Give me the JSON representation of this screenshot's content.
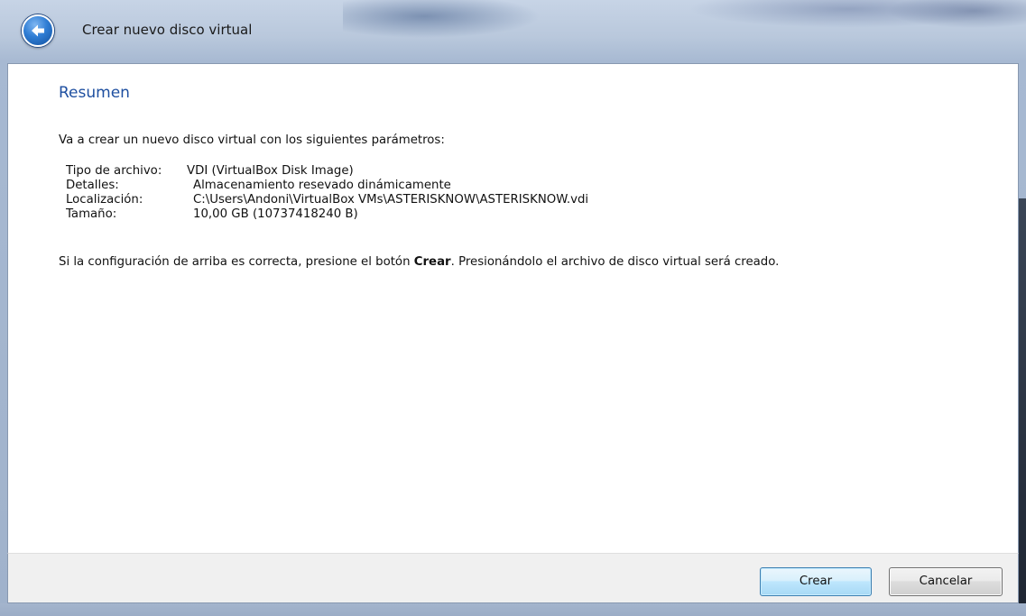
{
  "window": {
    "title": "Crear nuevo disco virtual"
  },
  "page": {
    "title": "Resumen",
    "intro": "Va a crear un nuevo disco virtual con los siguientes parámetros:",
    "params": [
      {
        "label": "Tipo de archivo:",
        "value": "VDI (VirtualBox Disk Image)"
      },
      {
        "label": "Detalles:",
        "value": "Almacenamiento resevado dinámicamente"
      },
      {
        "label": "Localización:",
        "value": "C:\\Users\\Andoni\\VirtualBox VMs\\ASTERISKNOW\\ASTERISKNOW.vdi"
      },
      {
        "label": "Tamaño:",
        "value": "10,00 GB (10737418240 B)"
      }
    ],
    "confirm_before": "Si la configuración de arriba es correcta, presione el botón ",
    "confirm_bold": "Crear",
    "confirm_after": ". Presionándolo el archivo de disco virtual será creado."
  },
  "buttons": {
    "create_label": "Crear",
    "cancel_label": "Cancelar"
  },
  "icons": {
    "back": "back-arrow-icon"
  },
  "colors": {
    "title_blue": "#1e4fa0",
    "primary_button_border": "#3c7fb1"
  }
}
